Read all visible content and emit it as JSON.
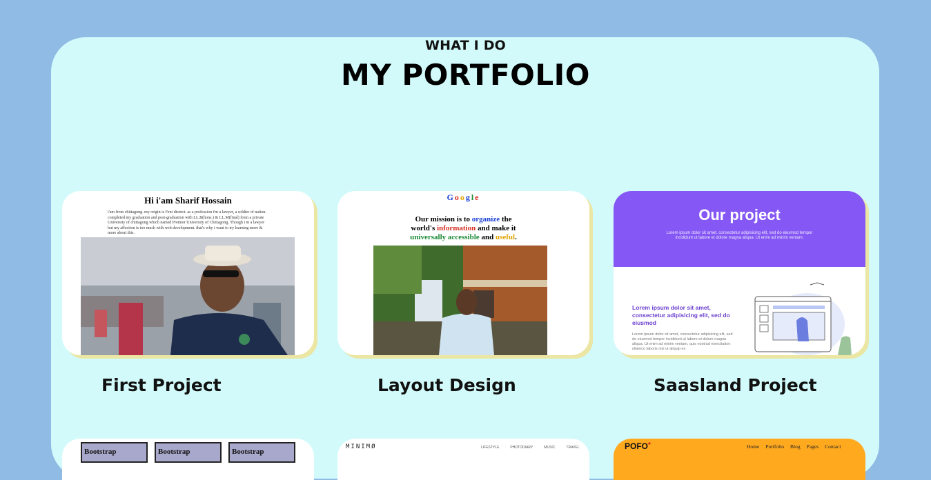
{
  "header": {
    "eyebrow": "WHAT I DO",
    "title": "MY PORTFOLIO"
  },
  "colors": {
    "page_bg": "#8fbbe4",
    "panel_bg": "#d2fafa",
    "card_shadow": "#ece6a4",
    "saasland_purple": "#8557f5",
    "pofo_orange": "#ffa91f"
  },
  "projects": [
    {
      "caption": "First Project",
      "preview": {
        "heading": "Hi i'am Sharif Hossain",
        "text": "i'am from chittagong. my origin is Feni district. as a profession i'm a lawyer, a soldier of nation. completed my graduation and post-graduation with LL.B(hons.) & LL.M(final) from a private University of chittagong which named Premier University of Chittagong. Though i m a lawyer but my affection is too much with web development. that's why i want to try learning more & more about this."
      }
    },
    {
      "caption": "Layout Design",
      "preview": {
        "logo": [
          "G",
          "o",
          "o",
          "g",
          "l",
          "e"
        ],
        "mission": [
          "Our mission is to ",
          "organize",
          " the",
          "world's ",
          "information",
          " and make it",
          "universally accessible",
          " and ",
          "useful",
          "."
        ]
      }
    },
    {
      "caption": "Saasland Project",
      "preview": {
        "heading": "Our project",
        "lorem": "Lorem ipsum dolor sit amet, consectetur adipisicing elit, sed do eiusmod tempor incididunt ut labore et dolore magna aliqua. Ut enim ad minim veniam.",
        "sub": "Lorem ipsum dolor sit amet, consectetur adipisicing elit, sed do eiusmod",
        "body": "Lorem ipsum dolor sit amet, consectetur adipisicing elit, sed do eiusmod tempor incididunt ut labore et dolore magna aliqua. Ut enim ad minim veniam, quis nostrud exercitation ullamco laboris nisi ut aliquip ex"
      }
    }
  ],
  "second_row": {
    "bootstrap": [
      "Bootstrap",
      "Bootstrap",
      "Bootstrap"
    ],
    "minimo": {
      "logo": "MINIMØ",
      "nav": [
        "LIFESTYLE",
        "PHOTODIARY",
        "MUSIC",
        "TRAVEL"
      ]
    },
    "pofo": {
      "logo": "POFO",
      "star": "*",
      "nav": [
        "Home",
        "Portfolio",
        "Blog",
        "Pages",
        "Contact"
      ]
    }
  }
}
